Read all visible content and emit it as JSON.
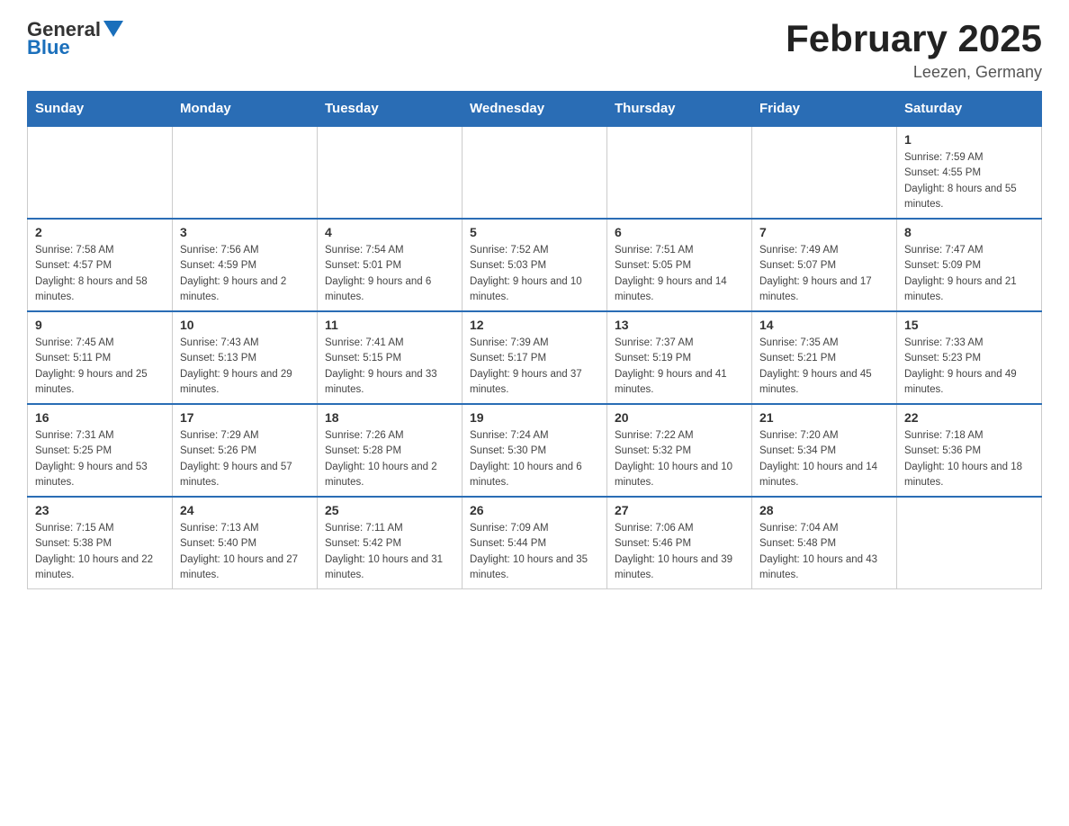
{
  "header": {
    "logo_general": "General",
    "logo_blue": "Blue",
    "month_title": "February 2025",
    "location": "Leezen, Germany"
  },
  "days_of_week": [
    "Sunday",
    "Monday",
    "Tuesday",
    "Wednesday",
    "Thursday",
    "Friday",
    "Saturday"
  ],
  "weeks": [
    {
      "days": [
        {
          "number": "",
          "info": "",
          "empty": true
        },
        {
          "number": "",
          "info": "",
          "empty": true
        },
        {
          "number": "",
          "info": "",
          "empty": true
        },
        {
          "number": "",
          "info": "",
          "empty": true
        },
        {
          "number": "",
          "info": "",
          "empty": true
        },
        {
          "number": "",
          "info": "",
          "empty": true
        },
        {
          "number": "1",
          "info": "Sunrise: 7:59 AM\nSunset: 4:55 PM\nDaylight: 8 hours and 55 minutes.",
          "empty": false
        }
      ]
    },
    {
      "days": [
        {
          "number": "2",
          "info": "Sunrise: 7:58 AM\nSunset: 4:57 PM\nDaylight: 8 hours and 58 minutes.",
          "empty": false
        },
        {
          "number": "3",
          "info": "Sunrise: 7:56 AM\nSunset: 4:59 PM\nDaylight: 9 hours and 2 minutes.",
          "empty": false
        },
        {
          "number": "4",
          "info": "Sunrise: 7:54 AM\nSunset: 5:01 PM\nDaylight: 9 hours and 6 minutes.",
          "empty": false
        },
        {
          "number": "5",
          "info": "Sunrise: 7:52 AM\nSunset: 5:03 PM\nDaylight: 9 hours and 10 minutes.",
          "empty": false
        },
        {
          "number": "6",
          "info": "Sunrise: 7:51 AM\nSunset: 5:05 PM\nDaylight: 9 hours and 14 minutes.",
          "empty": false
        },
        {
          "number": "7",
          "info": "Sunrise: 7:49 AM\nSunset: 5:07 PM\nDaylight: 9 hours and 17 minutes.",
          "empty": false
        },
        {
          "number": "8",
          "info": "Sunrise: 7:47 AM\nSunset: 5:09 PM\nDaylight: 9 hours and 21 minutes.",
          "empty": false
        }
      ]
    },
    {
      "days": [
        {
          "number": "9",
          "info": "Sunrise: 7:45 AM\nSunset: 5:11 PM\nDaylight: 9 hours and 25 minutes.",
          "empty": false
        },
        {
          "number": "10",
          "info": "Sunrise: 7:43 AM\nSunset: 5:13 PM\nDaylight: 9 hours and 29 minutes.",
          "empty": false
        },
        {
          "number": "11",
          "info": "Sunrise: 7:41 AM\nSunset: 5:15 PM\nDaylight: 9 hours and 33 minutes.",
          "empty": false
        },
        {
          "number": "12",
          "info": "Sunrise: 7:39 AM\nSunset: 5:17 PM\nDaylight: 9 hours and 37 minutes.",
          "empty": false
        },
        {
          "number": "13",
          "info": "Sunrise: 7:37 AM\nSunset: 5:19 PM\nDaylight: 9 hours and 41 minutes.",
          "empty": false
        },
        {
          "number": "14",
          "info": "Sunrise: 7:35 AM\nSunset: 5:21 PM\nDaylight: 9 hours and 45 minutes.",
          "empty": false
        },
        {
          "number": "15",
          "info": "Sunrise: 7:33 AM\nSunset: 5:23 PM\nDaylight: 9 hours and 49 minutes.",
          "empty": false
        }
      ]
    },
    {
      "days": [
        {
          "number": "16",
          "info": "Sunrise: 7:31 AM\nSunset: 5:25 PM\nDaylight: 9 hours and 53 minutes.",
          "empty": false
        },
        {
          "number": "17",
          "info": "Sunrise: 7:29 AM\nSunset: 5:26 PM\nDaylight: 9 hours and 57 minutes.",
          "empty": false
        },
        {
          "number": "18",
          "info": "Sunrise: 7:26 AM\nSunset: 5:28 PM\nDaylight: 10 hours and 2 minutes.",
          "empty": false
        },
        {
          "number": "19",
          "info": "Sunrise: 7:24 AM\nSunset: 5:30 PM\nDaylight: 10 hours and 6 minutes.",
          "empty": false
        },
        {
          "number": "20",
          "info": "Sunrise: 7:22 AM\nSunset: 5:32 PM\nDaylight: 10 hours and 10 minutes.",
          "empty": false
        },
        {
          "number": "21",
          "info": "Sunrise: 7:20 AM\nSunset: 5:34 PM\nDaylight: 10 hours and 14 minutes.",
          "empty": false
        },
        {
          "number": "22",
          "info": "Sunrise: 7:18 AM\nSunset: 5:36 PM\nDaylight: 10 hours and 18 minutes.",
          "empty": false
        }
      ]
    },
    {
      "days": [
        {
          "number": "23",
          "info": "Sunrise: 7:15 AM\nSunset: 5:38 PM\nDaylight: 10 hours and 22 minutes.",
          "empty": false
        },
        {
          "number": "24",
          "info": "Sunrise: 7:13 AM\nSunset: 5:40 PM\nDaylight: 10 hours and 27 minutes.",
          "empty": false
        },
        {
          "number": "25",
          "info": "Sunrise: 7:11 AM\nSunset: 5:42 PM\nDaylight: 10 hours and 31 minutes.",
          "empty": false
        },
        {
          "number": "26",
          "info": "Sunrise: 7:09 AM\nSunset: 5:44 PM\nDaylight: 10 hours and 35 minutes.",
          "empty": false
        },
        {
          "number": "27",
          "info": "Sunrise: 7:06 AM\nSunset: 5:46 PM\nDaylight: 10 hours and 39 minutes.",
          "empty": false
        },
        {
          "number": "28",
          "info": "Sunrise: 7:04 AM\nSunset: 5:48 PM\nDaylight: 10 hours and 43 minutes.",
          "empty": false
        },
        {
          "number": "",
          "info": "",
          "empty": true
        }
      ]
    }
  ]
}
